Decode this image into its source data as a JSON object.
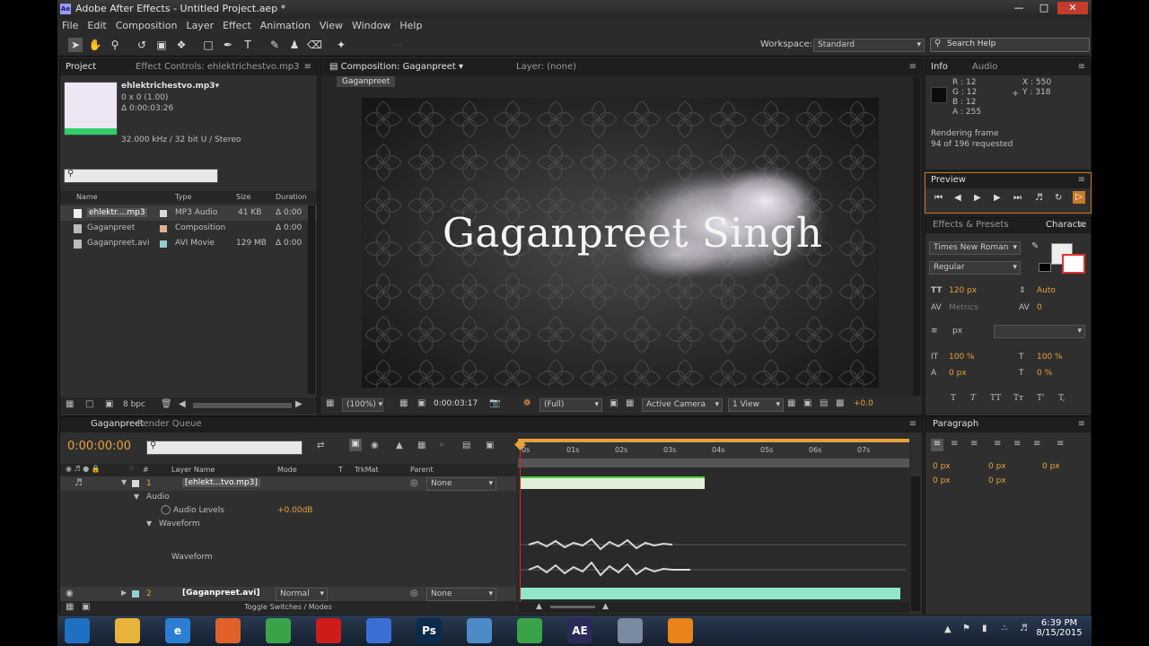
{
  "window": {
    "title": "Adobe After Effects - Untitled Project.aep *",
    "app_icon": "Ae"
  },
  "menu": [
    "File",
    "Edit",
    "Composition",
    "Layer",
    "Effect",
    "Animation",
    "View",
    "Window",
    "Help"
  ],
  "workspace": {
    "label": "Workspace:",
    "value": "Standard"
  },
  "search_help": {
    "placeholder": "Search Help"
  },
  "project": {
    "tab": "Project",
    "effect_controls_tab": "Effect Controls: ehlektrichestvo.mp3",
    "selected_name": "ehlektrichestvo.mp3▾",
    "dims": "0 x 0 (1.00)",
    "duration": "Δ 0:00:03:26",
    "audio_info": "32.000 kHz / 32 bit U / Stereo",
    "columns": [
      "Name",
      "Type",
      "Size",
      "Duration"
    ],
    "items": [
      {
        "name": "ehlektr....mp3",
        "type": "MP3 Audio",
        "size": "41 KB",
        "duration": "Δ 0:00",
        "color": "#d8d8d8"
      },
      {
        "name": "Gaganpreet",
        "type": "Composition",
        "size": "",
        "duration": "Δ 0:00",
        "color": "#e0b090"
      },
      {
        "name": "Gaganpreet.avi",
        "type": "AVI Movie",
        "size": "129 MB",
        "duration": "Δ 0:00",
        "color": "#90d0d0"
      }
    ],
    "bpc": "8 bpc"
  },
  "composition": {
    "tab": "Composition: Gaganpreet",
    "layer_tab": "Layer: (none)",
    "comp_button": "Gaganpreet",
    "viewer_text": "Gaganpreet Singh",
    "zoom": "(100%)",
    "timecode": "0:00:03:17",
    "resolution": "(Full)",
    "camera": "Active Camera",
    "views": "1 View",
    "exposure": "+0.0"
  },
  "info": {
    "tab": "Info",
    "audio_tab": "Audio",
    "r": "R : 12",
    "g": "G : 12",
    "b": "B : 12",
    "a": "A : 255",
    "x": "X : 550",
    "y": "Y : 318",
    "render_label": "Rendering frame",
    "render_status": "94 of 196 requested"
  },
  "preview": {
    "tab": "Preview"
  },
  "character": {
    "effects_tab": "Effects & Presets",
    "char_tab": "Characte",
    "font": "Times New Roman",
    "style": "Regular",
    "size": "120 px",
    "leading": "Auto",
    "kerning": "Metrics",
    "tracking": "0",
    "stroke_unit": "px",
    "vscale": "100 %",
    "hscale": "100 %",
    "baseline": "0 px",
    "tsume": "0 %",
    "style_buttons": [
      "T",
      "T",
      "TT",
      "Tт",
      "T'",
      "T,"
    ]
  },
  "paragraph": {
    "tab": "Paragraph",
    "indent": [
      "0 px",
      "0 px",
      "0 px",
      "0 px",
      "0 px"
    ]
  },
  "timeline": {
    "tab": "Gaganpreet",
    "render_tab": "Render Queue",
    "timecode": "0:00:00:00",
    "columns": [
      "Layer Name",
      "Mode",
      "T",
      "TrkMat",
      "Parent"
    ],
    "ruler": [
      "0s",
      "01s",
      "02s",
      "03s",
      "04s",
      "05s",
      "06s",
      "07s"
    ],
    "layers": [
      {
        "num": "1",
        "name": "[ehlekt...tvo.mp3]",
        "parent": "None"
      },
      {
        "num": "2",
        "name": "[Gaganpreet.avi]",
        "mode": "Normal",
        "parent": "None"
      }
    ],
    "audio_label": "Audio",
    "audio_levels": "Audio Levels",
    "audio_levels_value": "+0.00dB",
    "waveform_group": "Waveform",
    "waveform_label": "Waveform",
    "toggle": "Toggle Switches / Modes"
  },
  "taskbar": {
    "time": "6:39 PM",
    "date": "8/15/2015",
    "apps": [
      {
        "name": "start",
        "label": "",
        "color": "#1f6fc2"
      },
      {
        "name": "explorer",
        "label": "",
        "color": "#e8b33a"
      },
      {
        "name": "ie",
        "label": "e",
        "color": "#2a7fd4"
      },
      {
        "name": "media",
        "label": "",
        "color": "#e0602a"
      },
      {
        "name": "chrome",
        "label": "",
        "color": "#3aa34a"
      },
      {
        "name": "opera",
        "label": "",
        "color": "#d01b1b"
      },
      {
        "name": "apps",
        "label": "",
        "color": "#3b6fd6"
      },
      {
        "name": "photoshop",
        "label": "Ps",
        "color": "#0c2a4a"
      },
      {
        "name": "files",
        "label": "",
        "color": "#4d8ac8"
      },
      {
        "name": "chrome2",
        "label": "",
        "color": "#3aa34a"
      },
      {
        "name": "aftereffects",
        "label": "AE",
        "color": "#2a2a5a"
      },
      {
        "name": "window",
        "label": "",
        "color": "#7a8aa0"
      },
      {
        "name": "vlc",
        "label": "",
        "color": "#e8841a"
      }
    ]
  }
}
